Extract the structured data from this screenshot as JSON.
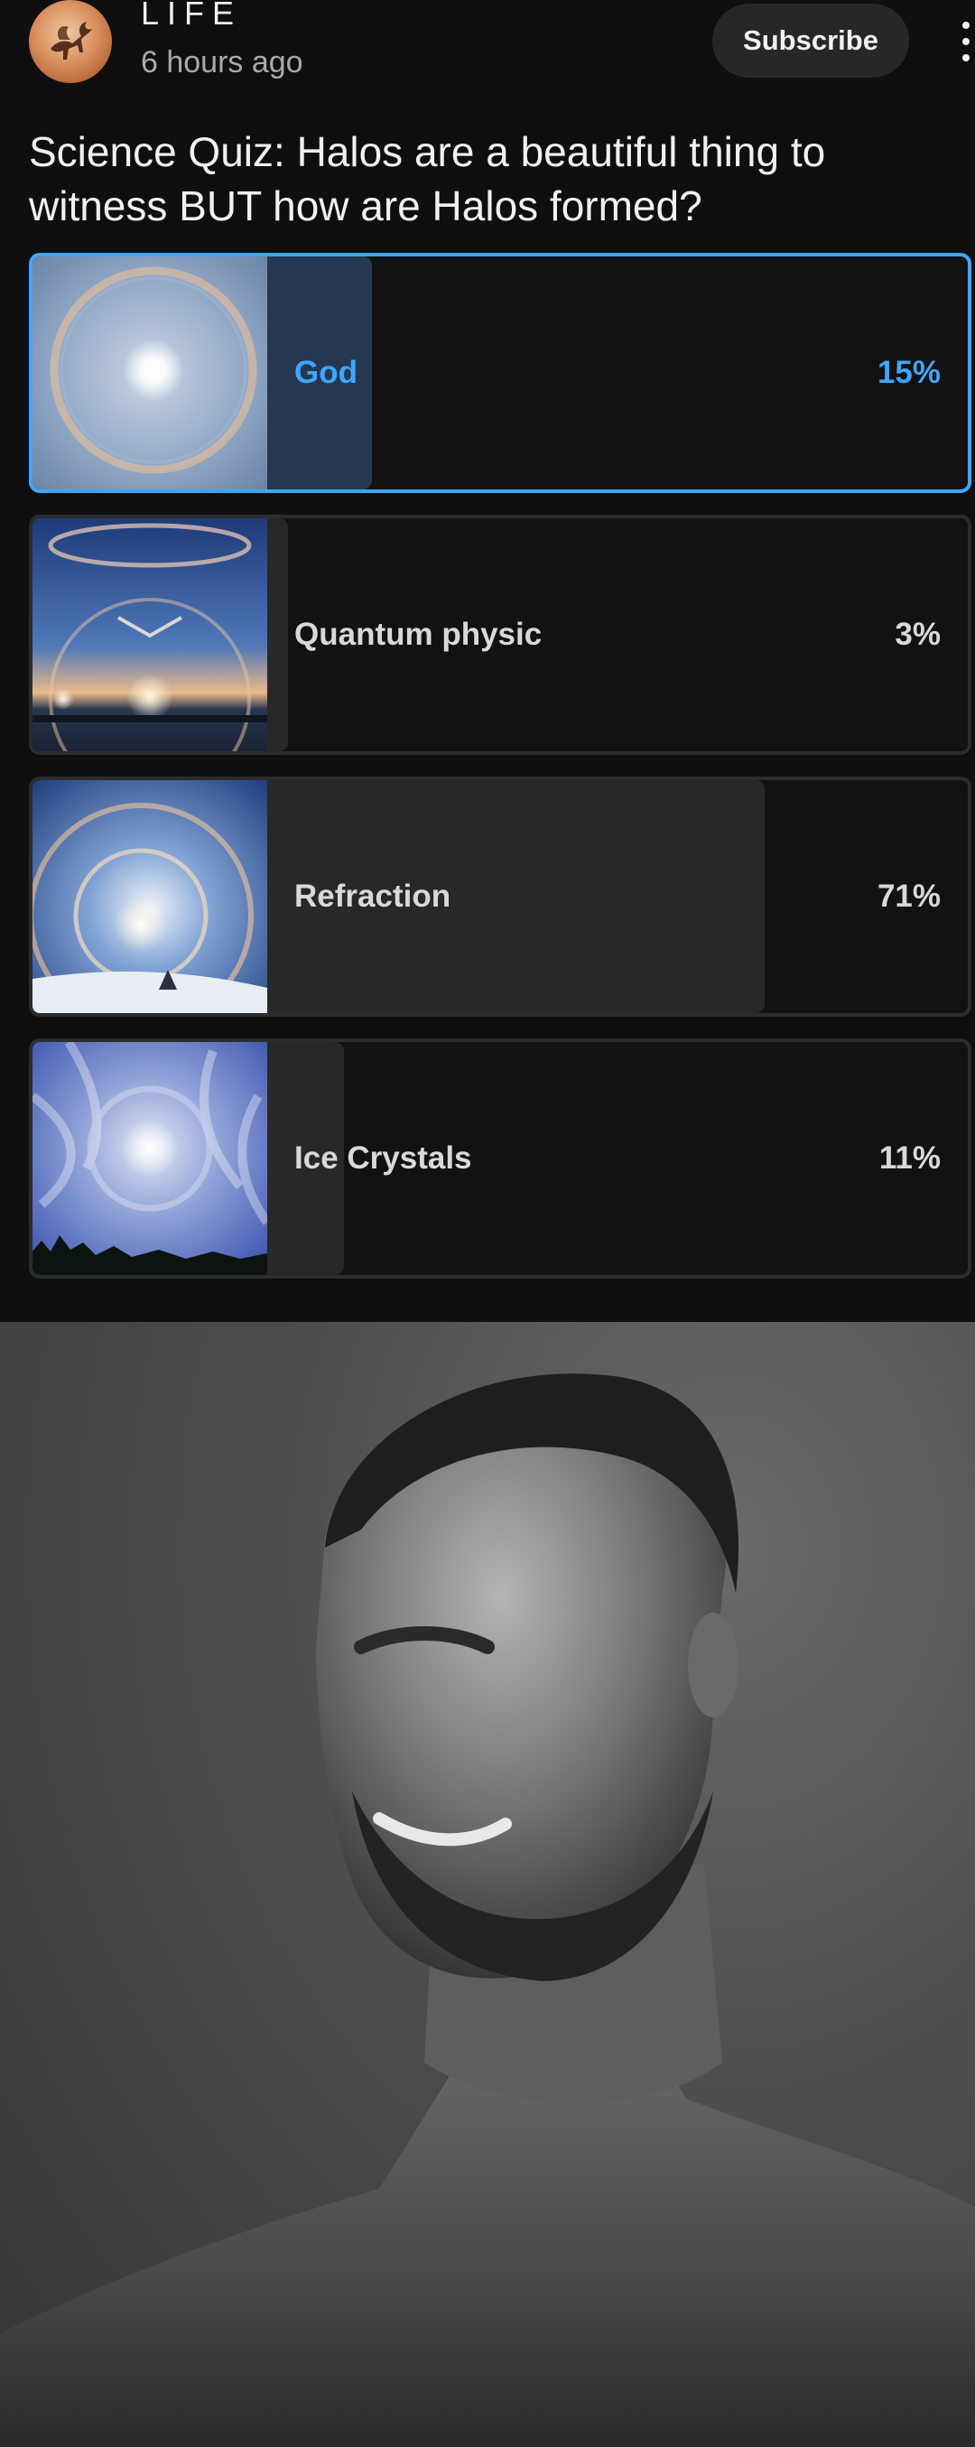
{
  "post": {
    "channel_name": "LIFE",
    "time_ago": "6 hours ago",
    "subscribe_label": "Subscribe",
    "question": "Science Quiz: Halos are a beautiful thing to witness BUT how are Halos formed?"
  },
  "poll": {
    "options": [
      {
        "label": "God",
        "percent": "15%",
        "share": 0.15,
        "selected": true
      },
      {
        "label": "Quantum physic",
        "percent": "3%",
        "share": 0.03,
        "selected": false
      },
      {
        "label": "Refraction",
        "percent": "71%",
        "share": 0.71,
        "selected": false
      },
      {
        "label": "Ice Crystals",
        "percent": "11%",
        "share": 0.11,
        "selected": false
      }
    ]
  },
  "icons": {
    "avatar": "pegasus-logo",
    "more": "vertical-ellipsis-icon"
  },
  "colors": {
    "background": "#0f0f0f",
    "selected_accent": "#3ea6ff",
    "subscribe_bg": "#272727"
  }
}
